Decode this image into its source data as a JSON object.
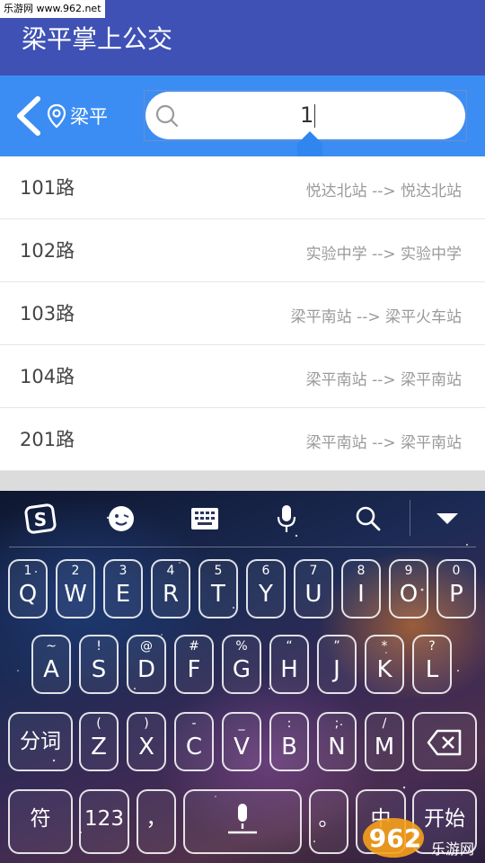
{
  "watermark": {
    "top_text": "乐游网 www.962.net",
    "badge_text": "962",
    "badge_sub": "乐游网"
  },
  "app": {
    "title": "梁平掌上公交"
  },
  "search": {
    "location": "梁平",
    "query": "1"
  },
  "routes": [
    {
      "name": "101路",
      "desc": "悦达北站 --> 悦达北站"
    },
    {
      "name": "102路",
      "desc": "实验中学 --> 实验中学"
    },
    {
      "name": "103路",
      "desc": "梁平南站 --> 梁平火车站"
    },
    {
      "name": "104路",
      "desc": "梁平南站 --> 梁平南站"
    },
    {
      "name": "201路",
      "desc": "梁平南站 --> 梁平南站"
    }
  ],
  "keyboard": {
    "toolbar": [
      "sogou-logo-icon",
      "emoji-icon",
      "keyboard-icon",
      "microphone-icon",
      "search-icon",
      "collapse-icon"
    ],
    "row1": [
      {
        "sub": "1",
        "main": "Q"
      },
      {
        "sub": "2",
        "main": "W"
      },
      {
        "sub": "3",
        "main": "E"
      },
      {
        "sub": "4",
        "main": "R"
      },
      {
        "sub": "5",
        "main": "T"
      },
      {
        "sub": "6",
        "main": "Y"
      },
      {
        "sub": "7",
        "main": "U"
      },
      {
        "sub": "8",
        "main": "I"
      },
      {
        "sub": "9",
        "main": "O"
      },
      {
        "sub": "0",
        "main": "P"
      }
    ],
    "row2": [
      {
        "sub": "~",
        "main": "A"
      },
      {
        "sub": "!",
        "main": "S"
      },
      {
        "sub": "@",
        "main": "D"
      },
      {
        "sub": "#",
        "main": "F"
      },
      {
        "sub": "%",
        "main": "G"
      },
      {
        "sub": "“",
        "main": "H"
      },
      {
        "sub": "”",
        "main": "J"
      },
      {
        "sub": "*",
        "main": "K"
      },
      {
        "sub": "?",
        "main": "L"
      }
    ],
    "row3": {
      "fenci": "分词",
      "letters": [
        {
          "sub": "(",
          "main": "Z"
        },
        {
          "sub": ")",
          "main": "X"
        },
        {
          "sub": "-",
          "main": "C"
        },
        {
          "sub": "_",
          "main": "V"
        },
        {
          "sub": ":",
          "main": "B"
        },
        {
          "sub": ";",
          "main": "N"
        },
        {
          "sub": "/",
          "main": "M"
        }
      ]
    },
    "row4": {
      "fu": "符",
      "num": "123",
      "comma": "，",
      "period": "。",
      "zhong": "中",
      "start": "开始"
    }
  },
  "colors": {
    "title_bar": "#3f51b5",
    "search_bar": "#3b8df3",
    "desc_text": "#9a9a9a"
  }
}
